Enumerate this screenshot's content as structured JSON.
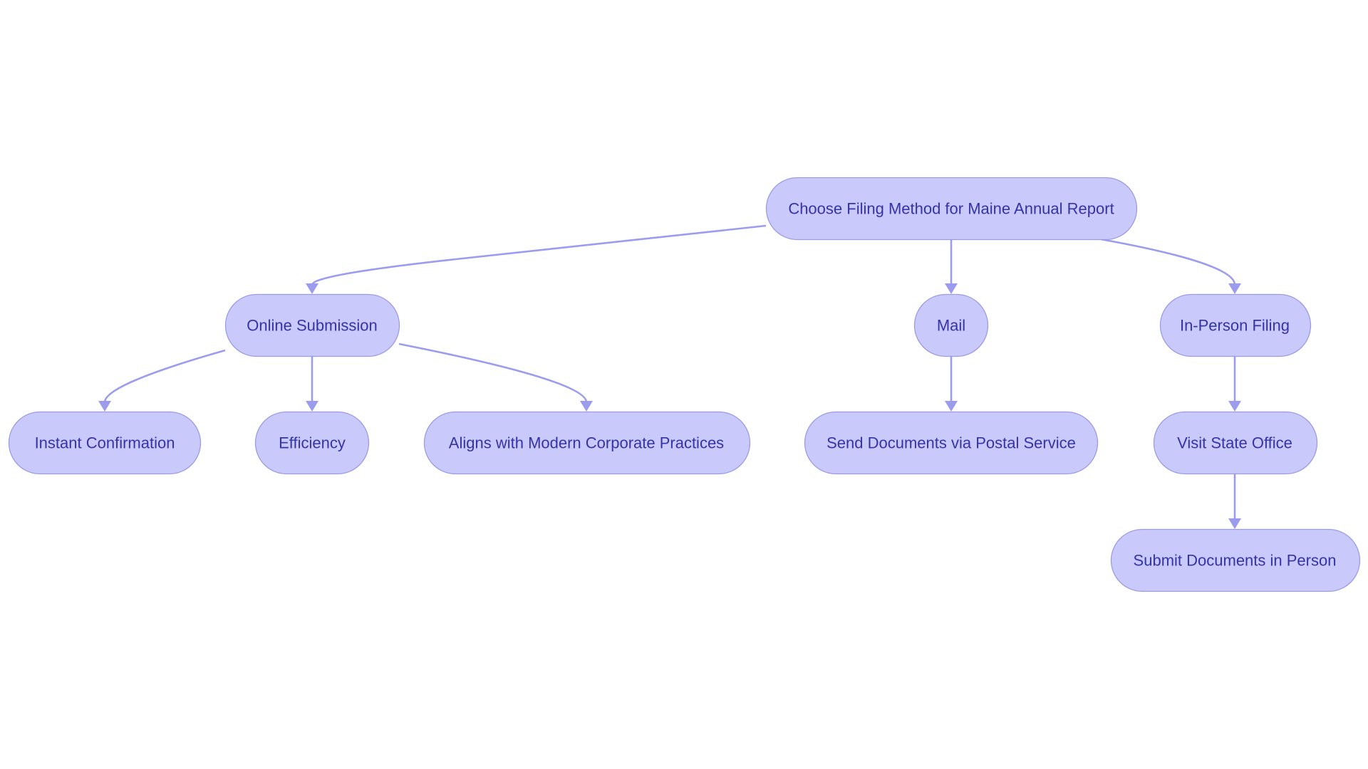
{
  "diagram": {
    "type": "flowchart",
    "direction": "top-down",
    "colors": {
      "node_fill": "#c9c9fc",
      "node_stroke": "#9c9ce6",
      "node_text": "#3434a8",
      "edge": "#9c9cee",
      "background": "#ffffff"
    },
    "nodes": [
      {
        "id": "root",
        "label": "Choose Filing Method for Maine Annual Report"
      },
      {
        "id": "online",
        "label": "Online Submission"
      },
      {
        "id": "mail",
        "label": "Mail"
      },
      {
        "id": "inperson",
        "label": "In-Person Filing"
      },
      {
        "id": "instant",
        "label": "Instant Confirmation"
      },
      {
        "id": "efficiency",
        "label": "Efficiency"
      },
      {
        "id": "aligns",
        "label": "Aligns with Modern Corporate Practices"
      },
      {
        "id": "send",
        "label": "Send Documents via Postal Service"
      },
      {
        "id": "visit",
        "label": "Visit State Office"
      },
      {
        "id": "submit",
        "label": "Submit Documents in Person"
      }
    ],
    "edges": [
      {
        "from": "root",
        "to": "online"
      },
      {
        "from": "root",
        "to": "mail"
      },
      {
        "from": "root",
        "to": "inperson"
      },
      {
        "from": "online",
        "to": "instant"
      },
      {
        "from": "online",
        "to": "efficiency"
      },
      {
        "from": "online",
        "to": "aligns"
      },
      {
        "from": "mail",
        "to": "send"
      },
      {
        "from": "inperson",
        "to": "visit"
      },
      {
        "from": "visit",
        "to": "submit"
      }
    ]
  }
}
